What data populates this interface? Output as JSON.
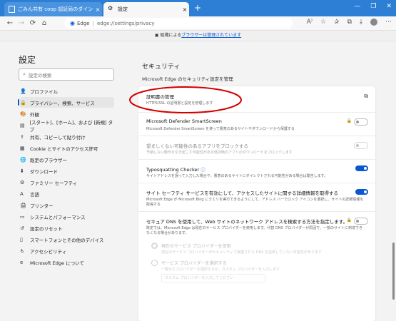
{
  "tabs": [
    {
      "label": "ごみん共有 coop 認証局のダイン",
      "close": "×"
    },
    {
      "label": "設定",
      "close": "×"
    }
  ],
  "new_tab": "+",
  "window_controls": [
    "—",
    "❐",
    "✕"
  ],
  "nav": {
    "back": "←",
    "forward": "→",
    "refresh": "⟳",
    "home": "⌂"
  },
  "address": {
    "brand": "Edge",
    "sep": "|",
    "url": "edge://settings/privacy"
  },
  "banner": {
    "prefix": "組織によるブラウザーは管理されています",
    "link": "ブラウザーは管理されています"
  },
  "sidebar": {
    "title": "設定",
    "search_placeholder": "設定の検索",
    "items": [
      {
        "icon": "👤",
        "label": "プロファイル"
      },
      {
        "icon": "🔒",
        "label": "プライバシー、検索、サービス"
      },
      {
        "icon": "🎨",
        "label": "外観"
      },
      {
        "icon": "▤",
        "label": "[スタート]、[ホーム]、および [新規] タブ"
      },
      {
        "icon": "⇪",
        "label": "共有、コピーして貼り付け"
      },
      {
        "icon": "▦",
        "label": "Cookie とサイトのアクセス許可"
      },
      {
        "icon": "🌐",
        "label": "既定のブラウザー"
      },
      {
        "icon": "⬇",
        "label": "ダウンロード"
      },
      {
        "icon": "⚙",
        "label": "ファミリー セーフティ"
      },
      {
        "icon": "A",
        "label": "言語"
      },
      {
        "icon": "🖨",
        "label": "プリンター"
      },
      {
        "icon": "▭",
        "label": "システムとパフォーマンス"
      },
      {
        "icon": "↺",
        "label": "設定のリセット"
      },
      {
        "icon": "▯",
        "label": "スマートフォンとその他のデバイス"
      },
      {
        "icon": "♿",
        "label": "アクセシビリティ"
      },
      {
        "icon": "e",
        "label": "Microsoft Edge について"
      }
    ]
  },
  "main": {
    "section_title": "セキュリティ",
    "section_sub": "Microsoft Edge のセキュリティ設定を管理",
    "rows": [
      {
        "title": "証明書の管理",
        "desc": "HTTPS/SSL の証明書と設定を管理します"
      },
      {
        "title": "Microsoft Defender SmartScreen",
        "desc": "Microsoft Defender SmartScreen を使って悪意のあるサイトやダウンロードから保護する"
      },
      {
        "title": "望ましくない可能性のあるアプリをブロックする",
        "desc": "予期しない動作を引き起こす可能性がある低評価のアプリのダウンロードをブロックします"
      },
      {
        "title": "Typosquatting Checker",
        "desc": "サイトアドレスを誤って入力した場合や、悪意のあるサイトにダイレクトされる可能性がある場合は警告します。"
      },
      {
        "title": "サイト セーフティ サービスを有効にして、アクセスしたサイトに関する詳細情報を取得する",
        "desc": "Microsoft Edge が Microsoft Bing にクエリを実行できるようにして、アドレス バーでロック アイコンを選択し、サイトの詳細情報を取得する"
      },
      {
        "title": "セキュア DNS を使用して、Web サイトのネットワーク アドレスを検索する方法を指定します。",
        "desc": "既定では、Microsoft Edge は現在のサービス プロバイダーを使用します。代替 DNS プロバイダーが原因で、一部のサイトに到達できなくなる場合があります。"
      }
    ],
    "dns_options": [
      {
        "label": "現在のサービス プロバイダーを使用",
        "sub": "現在のサービス プロバイダーがセキュリティで保護された DNS を提供していない可能性があります"
      },
      {
        "label": "サービス プロバイダーを選択する",
        "sub": "一覧からプロバイダーを選択するか、カスタム プロバイダーを入力します"
      }
    ],
    "dns_input_placeholder": "カスタム プロバイダーを入力してください"
  },
  "colors": {
    "accent": "#0b57d0",
    "tabbar": "#2d7fd6",
    "annotation": "#d40000"
  }
}
